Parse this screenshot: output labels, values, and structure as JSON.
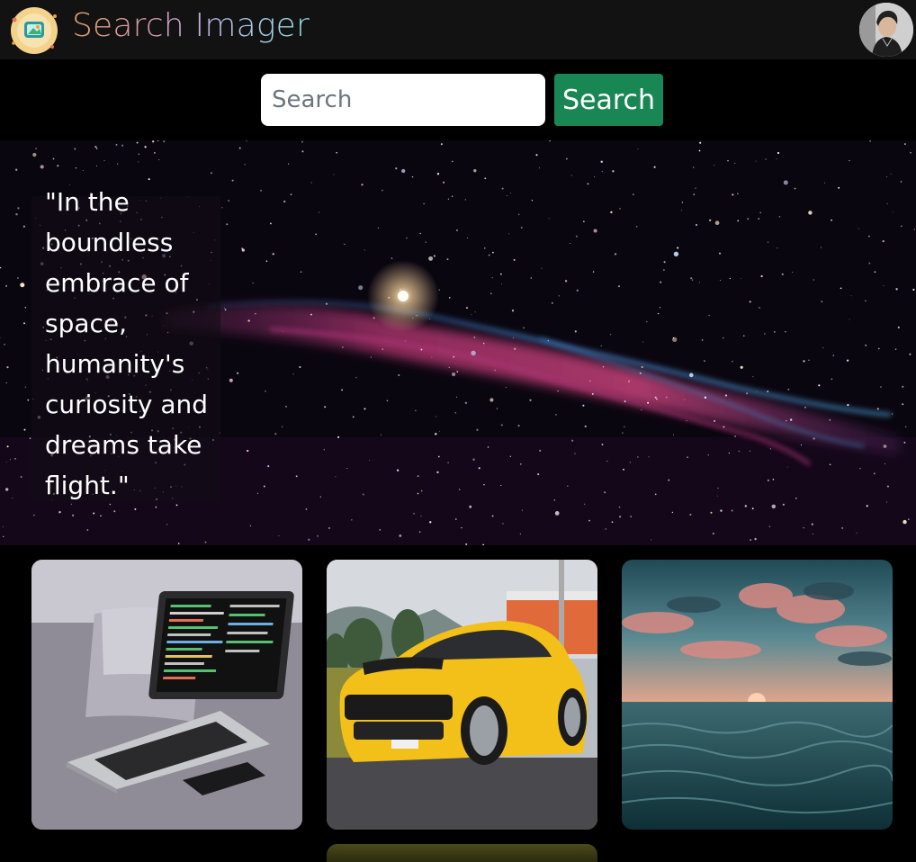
{
  "header": {
    "brand": "Search Imager"
  },
  "search": {
    "placeholder": "Search",
    "button_label": "Search"
  },
  "hero": {
    "quote": "\"In the boundless embrace of space, humanity's curiosity and dreams take flight.\""
  },
  "colors": {
    "navbar_bg": "#121212",
    "search_button": "#198754",
    "page_bg": "#000000"
  }
}
